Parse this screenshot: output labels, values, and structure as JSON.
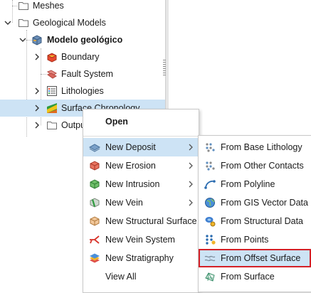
{
  "tree": {
    "rows": [
      {
        "label": "Meshes",
        "icon": "folder-icon"
      },
      {
        "label": "Geological Models",
        "icon": "folder-icon"
      },
      {
        "label": "Modelo geológico",
        "icon": "geological-model-icon"
      },
      {
        "label": "Boundary",
        "icon": "boundary-icon"
      },
      {
        "label": "Fault System",
        "icon": "fault-system-icon"
      },
      {
        "label": "Lithologies",
        "icon": "lithologies-icon"
      },
      {
        "label": "Surface Chronology",
        "icon": "surface-chronology-icon"
      },
      {
        "label": "Output",
        "icon": "folder-icon"
      }
    ]
  },
  "context_menu": {
    "open_label": "Open",
    "items": [
      {
        "label": "New Deposit",
        "icon": "deposit-icon",
        "submenu": true
      },
      {
        "label": "New Erosion",
        "icon": "erosion-icon",
        "submenu": true
      },
      {
        "label": "New Intrusion",
        "icon": "intrusion-icon",
        "submenu": true
      },
      {
        "label": "New Vein",
        "icon": "vein-icon",
        "submenu": true
      },
      {
        "label": "New Structural Surface",
        "icon": "structural-surface-icon",
        "submenu": false
      },
      {
        "label": "New Vein System",
        "icon": "vein-system-icon",
        "submenu": false
      },
      {
        "label": "New Stratigraphy",
        "icon": "stratigraphy-icon",
        "submenu": false
      },
      {
        "label": "View All",
        "icon": "",
        "submenu": false
      }
    ]
  },
  "submenu": {
    "items": [
      {
        "label": "From Base Lithology",
        "icon": "base-lithology-icon"
      },
      {
        "label": "From Other Contacts",
        "icon": "other-contacts-icon"
      },
      {
        "label": "From Polyline",
        "icon": "polyline-icon"
      },
      {
        "label": "From GIS Vector Data",
        "icon": "gis-vector-icon"
      },
      {
        "label": "From Structural Data",
        "icon": "structural-data-icon"
      },
      {
        "label": "From Points",
        "icon": "points-icon"
      },
      {
        "label": "From Offset Surface",
        "icon": "offset-surface-icon"
      },
      {
        "label": "From Surface",
        "icon": "surface-icon"
      }
    ]
  },
  "colors": {
    "selection": "#cde3f5",
    "highlight_box": "#d42027"
  }
}
